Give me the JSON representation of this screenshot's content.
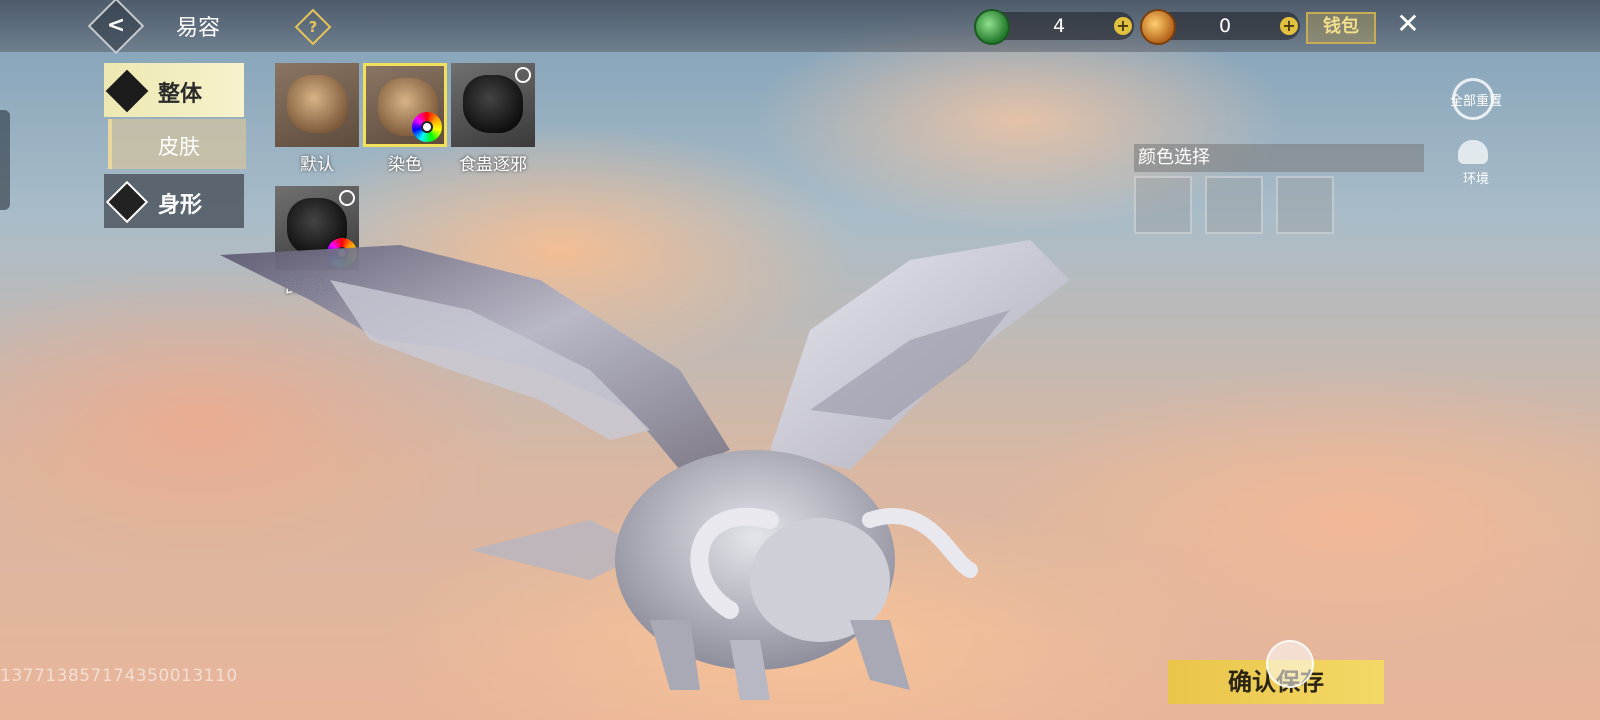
{
  "header": {
    "title": "易容",
    "help_icon": "?",
    "currencies": [
      {
        "icon": "jade-icon",
        "value": "4"
      },
      {
        "icon": "gold-coin-icon",
        "value": "0"
      }
    ],
    "wallet_label": "钱包",
    "close_icon": "✕"
  },
  "categories": [
    {
      "label": "整体",
      "active": true
    },
    {
      "label": "身形",
      "active": false
    }
  ],
  "subcategory": {
    "label": "皮肤"
  },
  "skins": [
    {
      "label": "默认",
      "locked": false,
      "dye": false,
      "selected": false
    },
    {
      "label": "染色",
      "locked": false,
      "dye": true,
      "selected": true
    },
    {
      "label": "食蛊逐邪",
      "locked": true,
      "dye": false,
      "selected": false
    },
    {
      "label": "食蛊逐邪",
      "locked": true,
      "dye": true,
      "selected": false
    }
  ],
  "color_panel": {
    "title": "颜色选择",
    "swatch_count": 3
  },
  "tools": {
    "reset_label": "全部重置",
    "environment_label": "环境"
  },
  "uid": "13771385717435001311​0",
  "save_button": "确认保存"
}
